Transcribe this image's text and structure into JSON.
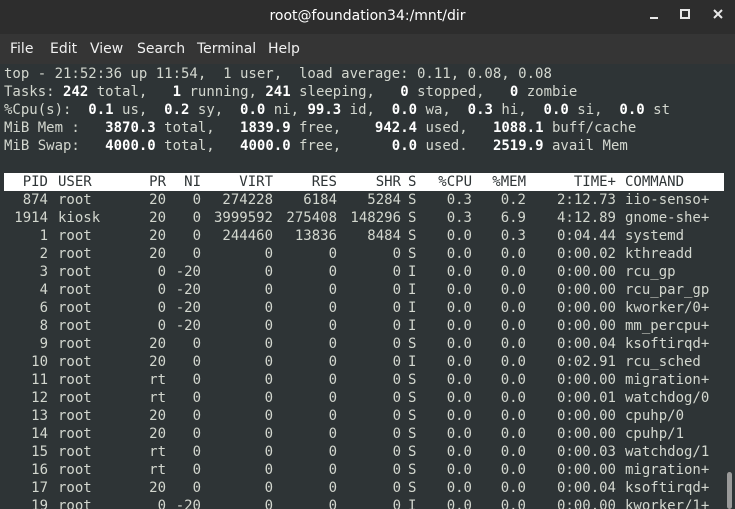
{
  "window": {
    "title": "root@foundation34:/mnt/dir"
  },
  "menu": [
    "File",
    "Edit",
    "View",
    "Search",
    "Terminal",
    "Help"
  ],
  "summary": {
    "l1": "top - 21:52:36 up 11:54,  1 user,  load average: 0.11, 0.08, 0.08",
    "tasks": {
      "label": "Tasks:",
      "total": "242",
      "total_lbl": " total,",
      "running": "1",
      "running_lbl": " running,",
      "sleeping": "241",
      "sleeping_lbl": " sleeping,",
      "stopped": "0",
      "stopped_lbl": " stopped,",
      "zombie": "0",
      "zombie_lbl": " zombie"
    },
    "cpu": {
      "label": "%Cpu(s):",
      "us": "0.1",
      "us_lbl": " us,",
      "sy": "0.2",
      "sy_lbl": " sy,",
      "ni": "0.0",
      "ni_lbl": " ni,",
      "id": "99.3",
      "id_lbl": " id,",
      "wa": "0.0",
      "wa_lbl": " wa,",
      "hi": "0.3",
      "hi_lbl": " hi,",
      "si": "0.0",
      "si_lbl": " si,",
      "st": "0.0",
      "st_lbl": " st"
    },
    "mem": {
      "label": "MiB Mem :",
      "total": "3870.3",
      "total_lbl": " total,",
      "free": "1839.9",
      "free_lbl": " free,",
      "used": "942.4",
      "used_lbl": " used,",
      "cache": "1088.1",
      "cache_lbl": " buff/cache"
    },
    "swap": {
      "label": "MiB Swap:",
      "total": "4000.0",
      "total_lbl": " total,",
      "free": "4000.0",
      "free_lbl": " free,",
      "used": "0.0",
      "used_lbl": " used.",
      "avail": "2519.9",
      "avail_lbl": " avail Mem"
    }
  },
  "table": {
    "headers": [
      "PID",
      "USER",
      "PR",
      "NI",
      "VIRT",
      "RES",
      "SHR",
      "S",
      "%CPU",
      "%MEM",
      "TIME+",
      "COMMAND"
    ],
    "rows": [
      [
        "874",
        "root",
        "20",
        "0",
        "274228",
        "6184",
        "5284",
        "S",
        "0.3",
        "0.2",
        "2:12.73",
        "iio-senso+"
      ],
      [
        "1914",
        "kiosk",
        "20",
        "0",
        "3999592",
        "275408",
        "148296",
        "S",
        "0.3",
        "6.9",
        "4:12.89",
        "gnome-she+"
      ],
      [
        "1",
        "root",
        "20",
        "0",
        "244460",
        "13836",
        "8484",
        "S",
        "0.0",
        "0.3",
        "0:04.44",
        "systemd"
      ],
      [
        "2",
        "root",
        "20",
        "0",
        "0",
        "0",
        "0",
        "S",
        "0.0",
        "0.0",
        "0:00.02",
        "kthreadd"
      ],
      [
        "3",
        "root",
        "0",
        "-20",
        "0",
        "0",
        "0",
        "I",
        "0.0",
        "0.0",
        "0:00.00",
        "rcu_gp"
      ],
      [
        "4",
        "root",
        "0",
        "-20",
        "0",
        "0",
        "0",
        "I",
        "0.0",
        "0.0",
        "0:00.00",
        "rcu_par_gp"
      ],
      [
        "6",
        "root",
        "0",
        "-20",
        "0",
        "0",
        "0",
        "I",
        "0.0",
        "0.0",
        "0:00.00",
        "kworker/0+"
      ],
      [
        "8",
        "root",
        "0",
        "-20",
        "0",
        "0",
        "0",
        "I",
        "0.0",
        "0.0",
        "0:00.00",
        "mm_percpu+"
      ],
      [
        "9",
        "root",
        "20",
        "0",
        "0",
        "0",
        "0",
        "S",
        "0.0",
        "0.0",
        "0:00.04",
        "ksoftirqd+"
      ],
      [
        "10",
        "root",
        "20",
        "0",
        "0",
        "0",
        "0",
        "I",
        "0.0",
        "0.0",
        "0:02.91",
        "rcu_sched"
      ],
      [
        "11",
        "root",
        "rt",
        "0",
        "0",
        "0",
        "0",
        "S",
        "0.0",
        "0.0",
        "0:00.00",
        "migration+"
      ],
      [
        "12",
        "root",
        "rt",
        "0",
        "0",
        "0",
        "0",
        "S",
        "0.0",
        "0.0",
        "0:00.01",
        "watchdog/0"
      ],
      [
        "13",
        "root",
        "20",
        "0",
        "0",
        "0",
        "0",
        "S",
        "0.0",
        "0.0",
        "0:00.00",
        "cpuhp/0"
      ],
      [
        "14",
        "root",
        "20",
        "0",
        "0",
        "0",
        "0",
        "S",
        "0.0",
        "0.0",
        "0:00.00",
        "cpuhp/1"
      ],
      [
        "15",
        "root",
        "rt",
        "0",
        "0",
        "0",
        "0",
        "S",
        "0.0",
        "0.0",
        "0:00.03",
        "watchdog/1"
      ],
      [
        "16",
        "root",
        "rt",
        "0",
        "0",
        "0",
        "0",
        "S",
        "0.0",
        "0.0",
        "0:00.00",
        "migration+"
      ],
      [
        "17",
        "root",
        "20",
        "0",
        "0",
        "0",
        "0",
        "S",
        "0.0",
        "0.0",
        "0:00.04",
        "ksoftirqd+"
      ],
      [
        "19",
        "root",
        "0",
        "-20",
        "0",
        "0",
        "0",
        "I",
        "0.0",
        "0.0",
        "0:00.00",
        "kworker/1+"
      ]
    ]
  }
}
